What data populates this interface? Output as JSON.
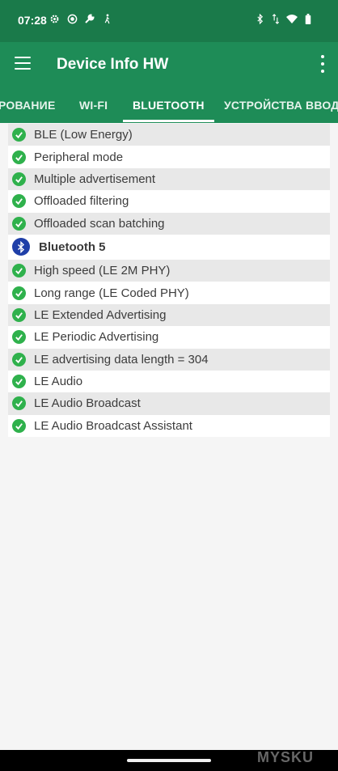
{
  "status_bar": {
    "time": "07:28"
  },
  "app_bar": {
    "title": "Device Info HW"
  },
  "tabs": [
    {
      "label": "РОВАНИЕ"
    },
    {
      "label": "WI-FI"
    },
    {
      "label": "BLUETOOTH"
    },
    {
      "label": "УСТРОЙСТВА ВВОДА"
    }
  ],
  "features": [
    {
      "label": "BLE (Low Energy)"
    },
    {
      "label": "Peripheral mode"
    },
    {
      "label": "Multiple advertisement"
    },
    {
      "label": "Offloaded filtering"
    },
    {
      "label": "Offloaded scan batching"
    }
  ],
  "bt5_header": {
    "label": "Bluetooth 5"
  },
  "bt5_features": [
    {
      "label": "High speed (LE 2M PHY)"
    },
    {
      "label": "Long range (LE Coded PHY)"
    },
    {
      "label": "LE Extended Advertising"
    },
    {
      "label": "LE Periodic Advertising"
    },
    {
      "label": "LE advertising data length = 304"
    },
    {
      "label": "LE Audio"
    },
    {
      "label": "LE Audio Broadcast"
    },
    {
      "label": "LE Audio Broadcast Assistant"
    }
  ],
  "watermark": "MYSKU",
  "colors": {
    "status_bar": "#1a7a4a",
    "app_bar": "#1e8c57",
    "check": "#2fb14c",
    "bluetooth": "#1f3fa8"
  },
  "icons": [
    "settings-icon",
    "screen-record-icon",
    "wrench-icon",
    "walk-icon",
    "bluetooth-icon",
    "data-arrows-icon",
    "wifi-icon",
    "battery-icon",
    "menu-icon",
    "more-vert-icon",
    "check-icon"
  ]
}
